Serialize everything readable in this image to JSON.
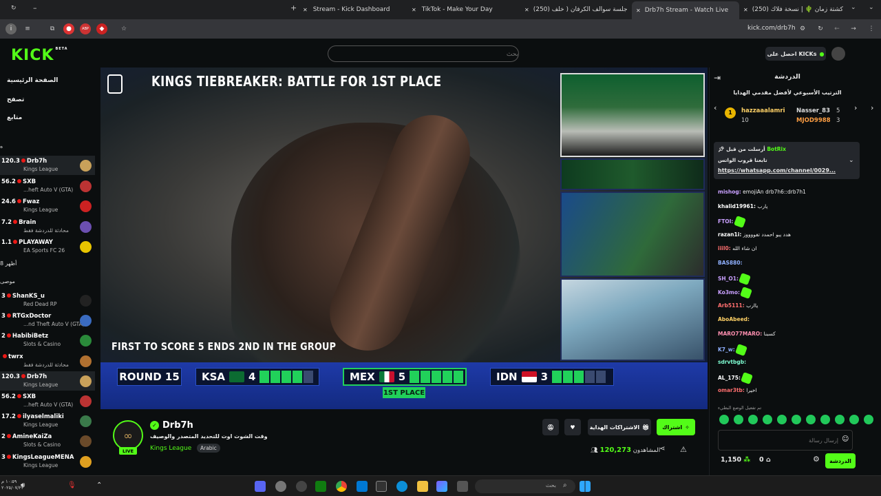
{
  "browser": {
    "tabs": [
      {
        "label": "Stream - Kick Dashboard"
      },
      {
        "label": "TikTok - Make Your Day"
      },
      {
        "label": "(250) جلسة سوالف الكرفان ( خلف"
      },
      {
        "label": "Drb7h Stream - Watch Live"
      },
      {
        "label": "(250) كشتة زمان 🌵 | نسخة فلاك"
      }
    ],
    "url": "kick.com/drb7h"
  },
  "header": {
    "logo": "KICK",
    "beta": "BETA",
    "search_placeholder": "بحث",
    "kicks_label": "احصل على KICKs"
  },
  "sidebar": {
    "nav": [
      "الصفحة الرئيسية",
      "تصفح",
      "متابع"
    ],
    "section_following": "ه",
    "following": [
      {
        "viewers": "120.3",
        "name": "Drb7h",
        "game": "Kings League",
        "sel": true,
        "color": "#c9a15a"
      },
      {
        "viewers": "56.2",
        "name": "SXB",
        "game": "...heft Auto V (GTA)",
        "color": "#b33"
      },
      {
        "viewers": "24.6",
        "name": "Fwaz",
        "game": "Kings League",
        "color": "#c22"
      },
      {
        "viewers": "7.2",
        "name": "Brain",
        "game": "محادثة للدردشة فقط",
        "color": "#6b4fb0"
      },
      {
        "viewers": "1.1",
        "name": "PLAYAWAY",
        "game": "EA Sports FC 26",
        "color": "#e8c400"
      }
    ],
    "more": "أظهر 8",
    "section_recommended": "موصى",
    "recommended": [
      {
        "viewers": "3",
        "name": "ShanKS_u",
        "game": "Red Dead RP",
        "color": "#222"
      },
      {
        "viewers": "3",
        "name": "RTGxDoctor",
        "game": "...nd Theft Auto V (GTA)",
        "color": "#3a6bc0"
      },
      {
        "viewers": "2",
        "name": "HabibiBetz",
        "game": "Slots & Casino",
        "color": "#2a8a3a"
      },
      {
        "viewers": "",
        "name": "twrx",
        "game": "محادثة للدردشة فقط",
        "color": "#b07030"
      },
      {
        "viewers": "120.3",
        "name": "Drb7h",
        "game": "Kings League",
        "sel": true,
        "color": "#c9a15a"
      },
      {
        "viewers": "56.2",
        "name": "SXB",
        "game": "...heft Auto V (GTA)",
        "color": "#b33"
      },
      {
        "viewers": "17.2",
        "name": "ilyaselmaliki",
        "game": "Kings League",
        "color": "#3a7a4a"
      },
      {
        "viewers": "2",
        "name": "AmineKaiZa",
        "game": "Slots & Casino",
        "color": "#6a4a2a"
      },
      {
        "viewers": "3",
        "name": "KingsLeagueMENA",
        "game": "Kings League",
        "color": "#e0a020"
      }
    ]
  },
  "video": {
    "title": "KINGS TIEBREAKER: BATTLE FOR 1ST PLACE",
    "banner": "FIRST TO SCORE 5 ENDS 2ND IN THE GROUP",
    "round": "ROUND 15",
    "teams": [
      {
        "code": "KSA",
        "score": "4",
        "pips": 4
      },
      {
        "code": "MEX",
        "score": "5",
        "pips": 5
      },
      {
        "code": "IDN",
        "score": "3",
        "pips": 3
      }
    ],
    "first_place": "1ST PLACE",
    "pip_total": 5,
    "colors": {
      "pip_on": "#21d15a",
      "pip_off": "#3a4a70"
    }
  },
  "stream": {
    "channel": "Drb7h",
    "live": "LIVE",
    "title": "وقت الشوت اوت للتحديد المتصدر والوصيف",
    "category": "Kings League",
    "language": "Arabic",
    "subscribe": "اشتراك",
    "gift": "الاشتراكات الهداية",
    "viewers_label": "المشاهدون",
    "viewers": "120,273"
  },
  "chat": {
    "title": "الدردشة",
    "leaderboard_title": "الترتيب الأسبوعي لأفضل مقدمي الهدايا",
    "leaders": [
      {
        "name": "hazzaaalamri",
        "count": "10"
      },
      {
        "name": "Nasser_83",
        "count": "5"
      },
      {
        "name": "MJOD9988",
        "count": "3"
      }
    ],
    "pinned": {
      "by": "أرسلت من قبل",
      "user": "BotRix",
      "text": "تابعنا قروب الواتس",
      "link": "https://whatsapp.com/channel/0029..."
    },
    "messages": [
      {
        "user": "mishog:",
        "text": "emojiAn drb7h6::drb7h1",
        "color": "#c9a0ff"
      },
      {
        "user": "khalid19961:",
        "text": "يارب",
        "color": "#ffffff"
      },
      {
        "user": "FTOI:",
        "text": "",
        "emote": true,
        "color": "#c9a0ff"
      },
      {
        "user": "razan1i:",
        "text": "هدد يبو احمدد تفووووز",
        "color": "#ffffff"
      },
      {
        "user": "iiiI0:",
        "text": "ان شاء الله",
        "color": "#ff6f6f"
      },
      {
        "user": "BAS880:",
        "text": "",
        "color": "#8fb0ff"
      },
      {
        "user": "SH_O1:",
        "text": "",
        "emote": true,
        "color": "#c9a0ff"
      },
      {
        "user": "Ko3mo:",
        "text": "",
        "emote": true,
        "color": "#c9a0ff"
      },
      {
        "user": "Arb5111:",
        "text": "ياارب",
        "color": "#ff6f6f"
      },
      {
        "user": "AboAbeed:",
        "text": "",
        "color": "#ffd166"
      },
      {
        "user": "MARO77MARO:",
        "text": "كسبنا",
        "color": "#ff8fb0"
      },
      {
        "user": "K7_w:",
        "text": "",
        "emote": true,
        "color": "#8fb0ff"
      },
      {
        "user": "sdrvtbgb:",
        "text": "",
        "color": "#7fffd4"
      },
      {
        "user": "AL_175:",
        "text": "",
        "emote": true,
        "color": "#ffffff"
      },
      {
        "user": "omar3tb:",
        "text": "اخيرا",
        "color": "#ff6f6f"
      }
    ],
    "system": "تم تفعيل الوضع البطيء",
    "input_placeholder": "إرسال رسالة",
    "points": "1,150",
    "points2": "0",
    "chat_button": "الدردشة"
  },
  "taskbar": {
    "search": "بحث",
    "time": "١٠:٥٩ م",
    "date": "٢٠٢٥/٠٧/٢٣"
  }
}
